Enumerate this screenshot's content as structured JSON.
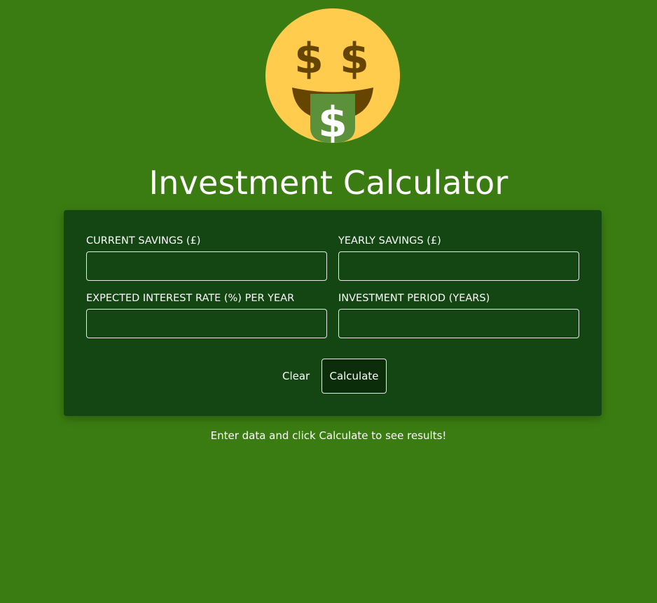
{
  "header": {
    "logo_icon": "money-mouth-face-icon",
    "title": "Investment Calculator"
  },
  "form": {
    "current_savings": {
      "label": "CURRENT SAVINGS (£)",
      "value": ""
    },
    "yearly_savings": {
      "label": "YEARLY SAVINGS (£)",
      "value": ""
    },
    "interest_rate": {
      "label": "EXPECTED INTEREST RATE (%) PER YEAR",
      "value": ""
    },
    "investment_period": {
      "label": "INVESTMENT PERIOD (YEARS)",
      "value": ""
    },
    "clear_label": "Clear",
    "calculate_label": "Calculate"
  },
  "results": {
    "message": "Enter data and click Calculate to see results!"
  },
  "colors": {
    "background": "#3a7c12",
    "panel": "#134612",
    "button": "#0b2d0a",
    "face": "#ffcc4d",
    "dollar": "#664500",
    "tongue": "#5c913b"
  }
}
